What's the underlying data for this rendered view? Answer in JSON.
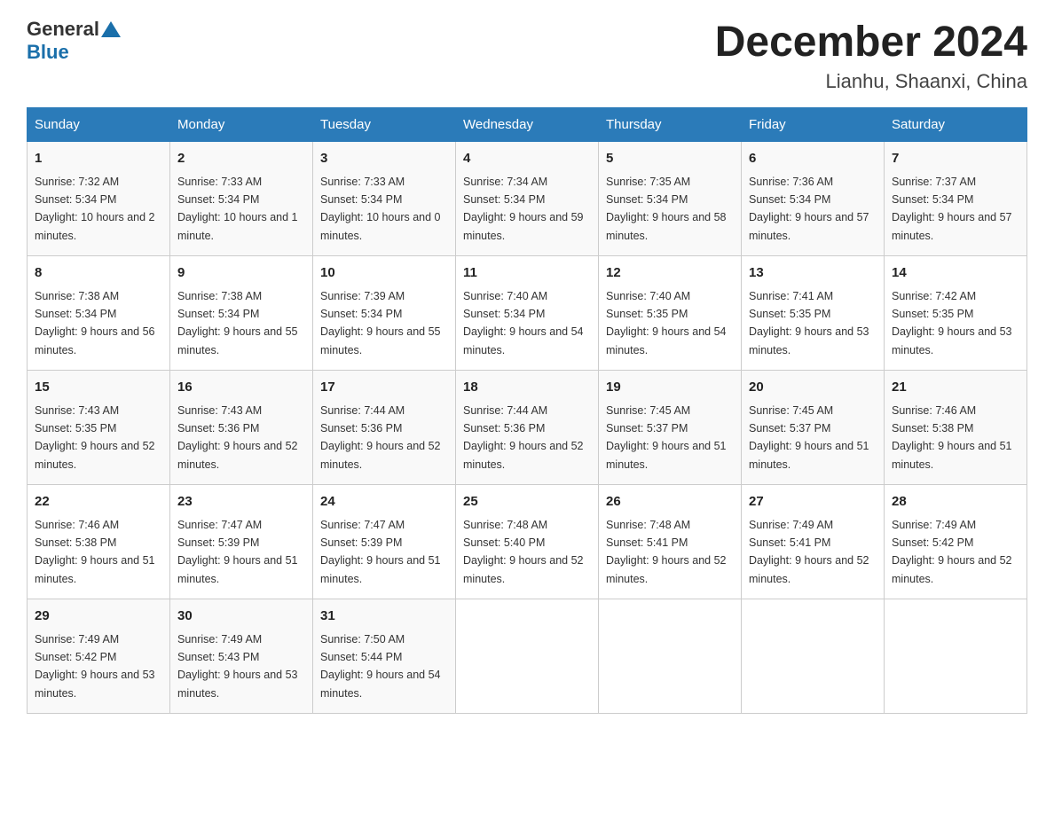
{
  "header": {
    "logo_general": "General",
    "logo_blue": "Blue",
    "title": "December 2024",
    "subtitle": "Lianhu, Shaanxi, China"
  },
  "weekdays": [
    "Sunday",
    "Monday",
    "Tuesday",
    "Wednesday",
    "Thursday",
    "Friday",
    "Saturday"
  ],
  "weeks": [
    [
      {
        "day": "1",
        "sunrise": "7:32 AM",
        "sunset": "5:34 PM",
        "daylight": "10 hours and 2 minutes."
      },
      {
        "day": "2",
        "sunrise": "7:33 AM",
        "sunset": "5:34 PM",
        "daylight": "10 hours and 1 minute."
      },
      {
        "day": "3",
        "sunrise": "7:33 AM",
        "sunset": "5:34 PM",
        "daylight": "10 hours and 0 minutes."
      },
      {
        "day": "4",
        "sunrise": "7:34 AM",
        "sunset": "5:34 PM",
        "daylight": "9 hours and 59 minutes."
      },
      {
        "day": "5",
        "sunrise": "7:35 AM",
        "sunset": "5:34 PM",
        "daylight": "9 hours and 58 minutes."
      },
      {
        "day": "6",
        "sunrise": "7:36 AM",
        "sunset": "5:34 PM",
        "daylight": "9 hours and 57 minutes."
      },
      {
        "day": "7",
        "sunrise": "7:37 AM",
        "sunset": "5:34 PM",
        "daylight": "9 hours and 57 minutes."
      }
    ],
    [
      {
        "day": "8",
        "sunrise": "7:38 AM",
        "sunset": "5:34 PM",
        "daylight": "9 hours and 56 minutes."
      },
      {
        "day": "9",
        "sunrise": "7:38 AM",
        "sunset": "5:34 PM",
        "daylight": "9 hours and 55 minutes."
      },
      {
        "day": "10",
        "sunrise": "7:39 AM",
        "sunset": "5:34 PM",
        "daylight": "9 hours and 55 minutes."
      },
      {
        "day": "11",
        "sunrise": "7:40 AM",
        "sunset": "5:34 PM",
        "daylight": "9 hours and 54 minutes."
      },
      {
        "day": "12",
        "sunrise": "7:40 AM",
        "sunset": "5:35 PM",
        "daylight": "9 hours and 54 minutes."
      },
      {
        "day": "13",
        "sunrise": "7:41 AM",
        "sunset": "5:35 PM",
        "daylight": "9 hours and 53 minutes."
      },
      {
        "day": "14",
        "sunrise": "7:42 AM",
        "sunset": "5:35 PM",
        "daylight": "9 hours and 53 minutes."
      }
    ],
    [
      {
        "day": "15",
        "sunrise": "7:43 AM",
        "sunset": "5:35 PM",
        "daylight": "9 hours and 52 minutes."
      },
      {
        "day": "16",
        "sunrise": "7:43 AM",
        "sunset": "5:36 PM",
        "daylight": "9 hours and 52 minutes."
      },
      {
        "day": "17",
        "sunrise": "7:44 AM",
        "sunset": "5:36 PM",
        "daylight": "9 hours and 52 minutes."
      },
      {
        "day": "18",
        "sunrise": "7:44 AM",
        "sunset": "5:36 PM",
        "daylight": "9 hours and 52 minutes."
      },
      {
        "day": "19",
        "sunrise": "7:45 AM",
        "sunset": "5:37 PM",
        "daylight": "9 hours and 51 minutes."
      },
      {
        "day": "20",
        "sunrise": "7:45 AM",
        "sunset": "5:37 PM",
        "daylight": "9 hours and 51 minutes."
      },
      {
        "day": "21",
        "sunrise": "7:46 AM",
        "sunset": "5:38 PM",
        "daylight": "9 hours and 51 minutes."
      }
    ],
    [
      {
        "day": "22",
        "sunrise": "7:46 AM",
        "sunset": "5:38 PM",
        "daylight": "9 hours and 51 minutes."
      },
      {
        "day": "23",
        "sunrise": "7:47 AM",
        "sunset": "5:39 PM",
        "daylight": "9 hours and 51 minutes."
      },
      {
        "day": "24",
        "sunrise": "7:47 AM",
        "sunset": "5:39 PM",
        "daylight": "9 hours and 51 minutes."
      },
      {
        "day": "25",
        "sunrise": "7:48 AM",
        "sunset": "5:40 PM",
        "daylight": "9 hours and 52 minutes."
      },
      {
        "day": "26",
        "sunrise": "7:48 AM",
        "sunset": "5:41 PM",
        "daylight": "9 hours and 52 minutes."
      },
      {
        "day": "27",
        "sunrise": "7:49 AM",
        "sunset": "5:41 PM",
        "daylight": "9 hours and 52 minutes."
      },
      {
        "day": "28",
        "sunrise": "7:49 AM",
        "sunset": "5:42 PM",
        "daylight": "9 hours and 52 minutes."
      }
    ],
    [
      {
        "day": "29",
        "sunrise": "7:49 AM",
        "sunset": "5:42 PM",
        "daylight": "9 hours and 53 minutes."
      },
      {
        "day": "30",
        "sunrise": "7:49 AM",
        "sunset": "5:43 PM",
        "daylight": "9 hours and 53 minutes."
      },
      {
        "day": "31",
        "sunrise": "7:50 AM",
        "sunset": "5:44 PM",
        "daylight": "9 hours and 54 minutes."
      },
      null,
      null,
      null,
      null
    ]
  ]
}
